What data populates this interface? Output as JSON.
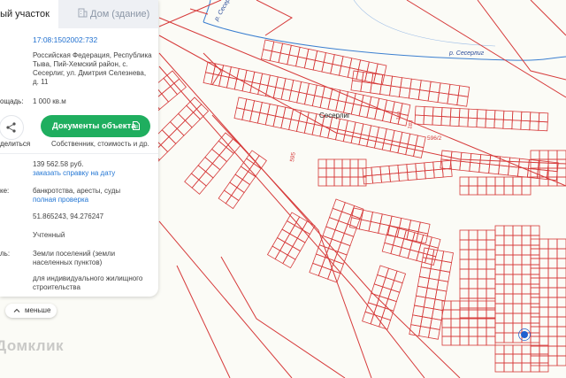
{
  "tabs": {
    "land_plot": "ный участок",
    "building": "Дом (здание)"
  },
  "info": {
    "cadastral_number": "17:08:1502002:732",
    "address": [
      "Российская Федерация, Республика",
      "Тыва, Пий-Хемский район, с.",
      "Сесерлиг, ул. Дмитрия Селезнева,",
      "д. 11"
    ],
    "area_label": "ощадь:",
    "area_value": "1 000 кв.м",
    "share_label": "делиться",
    "docs_button": "Документы объекта",
    "docs_subtitle": "Собственник, стоимость и др.",
    "cost_value": "139 562.58 руб.",
    "cost_link": "заказать справку на дату",
    "checks_label": "ке:",
    "checks_value": "банкротства, аресты, суды",
    "checks_link": "полная проверка",
    "coordinates": "51.865243, 94.276247",
    "status": "Учтенный",
    "category_label": "ль:",
    "category_value": [
      "Земли поселений (земли",
      "населенных пунктов)"
    ],
    "use_value": [
      "для индивидуального жилищного",
      "строительства"
    ]
  },
  "controls": {
    "less_button": "меньше"
  },
  "map": {
    "watermark": "Домклик",
    "village_label": "Сесерлиг",
    "river_label_1": "р. Сесерлиг",
    "river_label_2": "р. Сесерлиг",
    "plot_labels": [
      "595",
      "596/2",
      "182",
      "183"
    ],
    "boundary_color": "#d63a3a",
    "river_color": "#3b7fd0",
    "marker_color": "#1f5fcf"
  },
  "colors": {
    "accent_green": "#1fae5f",
    "link_blue": "#2477d4"
  }
}
